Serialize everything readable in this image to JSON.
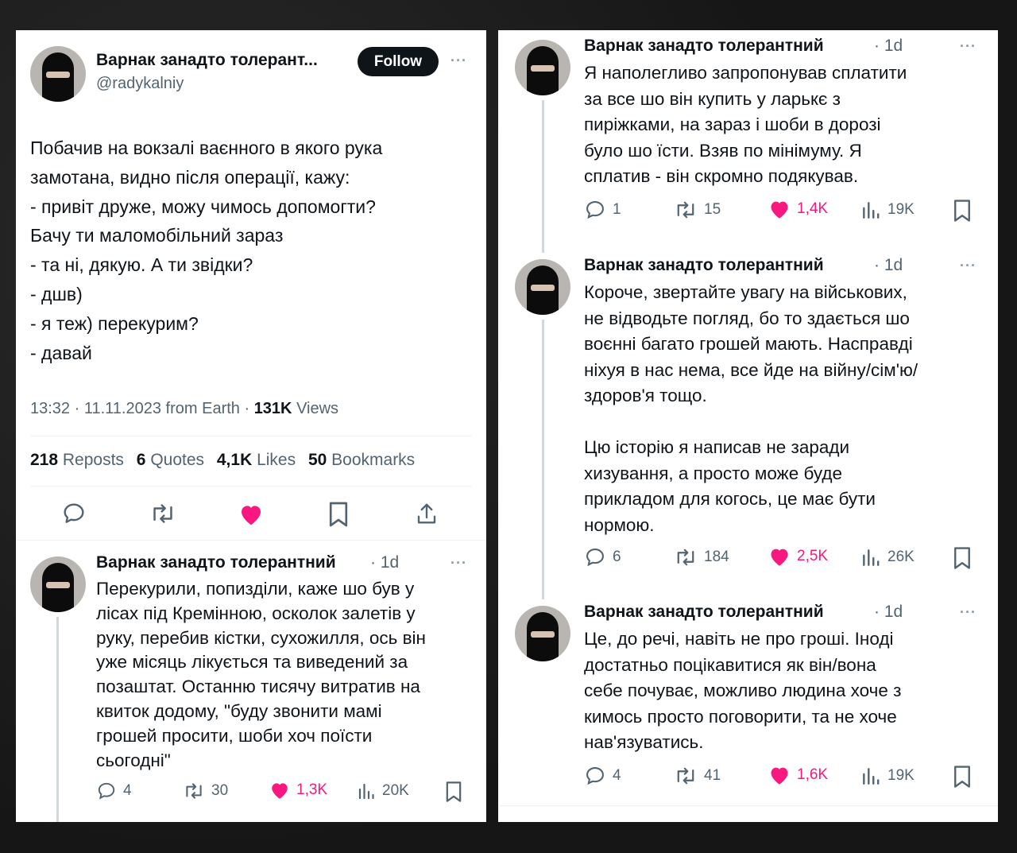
{
  "main_tweet": {
    "author_name": "Варнак занадто толерант...",
    "handle": "@radykalniy",
    "follow_label": "Follow",
    "more": "···",
    "text": "Побачив на вокзалі ваєнного в якого рука\nзамотана, видно після операції, кажу:\n- привіт друже, можу чимось допомогти?\nБачу ти маломобільний зараз\n- та ні, дякую. А ти звідки?\n- дшв)\n- я теж) перекурим?\n- давай",
    "time": "13:32",
    "date": "11.11.2023",
    "source": "from Earth",
    "views_count": "131K",
    "views_label": "Views",
    "stats": {
      "reposts_count": "218",
      "reposts_label": "Reposts",
      "quotes_count": "6",
      "quotes_label": "Quotes",
      "likes_count": "4,1K",
      "likes_label": "Likes",
      "bookmarks_count": "50",
      "bookmarks_label": "Bookmarks"
    }
  },
  "replies": [
    {
      "author_name": "Варнак занадто толерантний",
      "time": "· 1d",
      "more": "···",
      "text": "Перекурили, попизділи, каже шо був у\nлісах під Кремінною, осколок залетів у\nруку, перебив кістки, сухожилля, ось він\nуже місяць лікується та виведений за\nпозаштат. Останню тисячу витратив на\nквиток додому, \"буду звонити мамі\nгрошей просити, шоби хоч поїсти\nсьогодні\"",
      "replies": "4",
      "reposts": "30",
      "likes": "1,3K",
      "views": "20K"
    },
    {
      "author_name": "Варнак занадто толерантний",
      "time": "· 1d",
      "more": "···",
      "text": "Я наполегливо запропонував сплатити\nза все шо він купить у ларькє з\nпиріжками, на зараз і шоби в дорозі\nбуло шо їсти. Взяв по мінімуму. Я\nсплатив - він скромно подякував.",
      "replies": "1",
      "reposts": "15",
      "likes": "1,4K",
      "views": "19K"
    },
    {
      "author_name": "Варнак занадто толерантний",
      "time": "· 1d",
      "more": "···",
      "text": "Короче, звертайте увагу на військових,\nне відводьте погляд, бо то здається шо\nвоєнні багато грошей мають. Насправді\nніхуя в нас нема, все йде на війну/сім'ю/\nздоров'я тощо.\n\nЦю історію я написав не заради\nхизування, а просто може буде\nприкладом для когось, це має бути\nнормою.",
      "replies": "6",
      "reposts": "184",
      "likes": "2,5K",
      "views": "26K"
    },
    {
      "author_name": "Варнак занадто толерантний",
      "time": "· 1d",
      "more": "···",
      "text": "Це, до речі, навіть не про гроші. Іноді\nдостатньо поцікавитися як він/вона\nсебе почуває, можливо людина хоче з\nкимось просто поговорити, та не хоче\nнав'язуватись.",
      "replies": "4",
      "reposts": "41",
      "likes": "1,6K",
      "views": "19K"
    }
  ],
  "icons": {
    "reply": "reply-bubble-icon",
    "repost": "repost-arrows-icon",
    "like": "heart-icon",
    "views": "views-bar-chart-icon",
    "bookmark": "bookmark-icon",
    "share": "share-upload-icon"
  },
  "colors": {
    "like": "#f91880",
    "follow_bg": "#0f1419",
    "muted": "#536471",
    "background": "#1c1c1c"
  }
}
